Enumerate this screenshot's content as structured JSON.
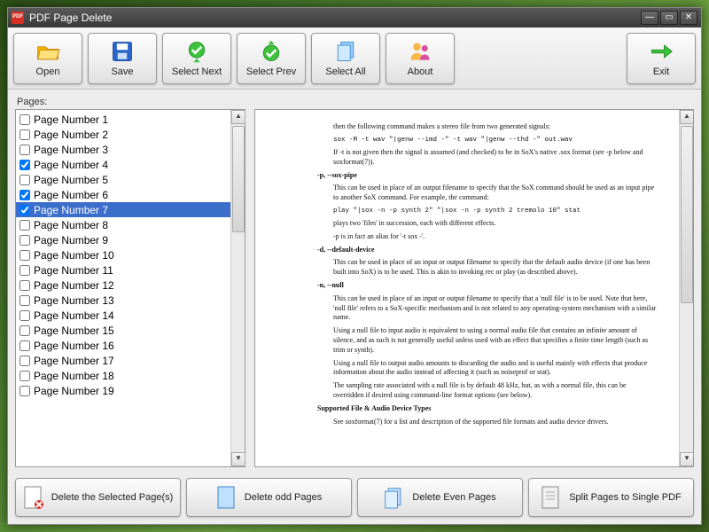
{
  "window": {
    "title": "PDF Page Delete"
  },
  "toolbar": {
    "open": "Open",
    "save": "Save",
    "select_next": "Select Next",
    "select_prev": "Select Prev",
    "select_all": "Select All",
    "about": "About",
    "exit": "Exit"
  },
  "pages_label": "Pages:",
  "pages": [
    {
      "label": "Page Number 1",
      "checked": false,
      "selected": false
    },
    {
      "label": "Page Number 2",
      "checked": false,
      "selected": false
    },
    {
      "label": "Page Number 3",
      "checked": false,
      "selected": false
    },
    {
      "label": "Page Number 4",
      "checked": true,
      "selected": false
    },
    {
      "label": "Page Number 5",
      "checked": false,
      "selected": false
    },
    {
      "label": "Page Number 6",
      "checked": true,
      "selected": false
    },
    {
      "label": "Page Number 7",
      "checked": true,
      "selected": true
    },
    {
      "label": "Page Number 8",
      "checked": false,
      "selected": false
    },
    {
      "label": "Page Number 9",
      "checked": false,
      "selected": false
    },
    {
      "label": "Page Number 10",
      "checked": false,
      "selected": false
    },
    {
      "label": "Page Number 11",
      "checked": false,
      "selected": false
    },
    {
      "label": "Page Number 12",
      "checked": false,
      "selected": false
    },
    {
      "label": "Page Number 13",
      "checked": false,
      "selected": false
    },
    {
      "label": "Page Number 14",
      "checked": false,
      "selected": false
    },
    {
      "label": "Page Number 15",
      "checked": false,
      "selected": false
    },
    {
      "label": "Page Number 16",
      "checked": false,
      "selected": false
    },
    {
      "label": "Page Number 17",
      "checked": false,
      "selected": false
    },
    {
      "label": "Page Number 18",
      "checked": false,
      "selected": false
    },
    {
      "label": "Page Number 19",
      "checked": false,
      "selected": false
    }
  ],
  "preview": {
    "lines": {
      "l1": "then the following command makes a stereo file from two generated signals:",
      "l2": "sox -M -t wav \"|genw --imd -\" -t wav \"|genw --thd -\" out.wav",
      "l3": "If -t is not given then the signal is assumed (and checked) to be in SoX's native .sox format (see -p below and soxformat(7)).",
      "o1": "-p, --sox-pipe",
      "l4": "This can be used in place of an output filename to specify that the SoX command should be used as an input pipe to another SoX command.  For example, the command:",
      "l5": "play \"|sox -n -p synth 2\" \"|sox -n -p synth 2 tremolo 10\" stat",
      "l6": "plays two 'files' in succession, each with different effects.",
      "l7": "-p is in fact an alias for '-t sox -'.",
      "o2": "-d, --default-device",
      "l8": "This can be used in place of an input or output filename to specify that the default audio device (if one has been built into SoX) is to be used.  This is akin to invoking rec or play (as described above).",
      "o3": "-n, --null",
      "l9": "This can be used in place of an input or output filename to specify that a 'null file' is to be used. Note that here, 'null file' refers to a SoX-specific mechanism and is not related to any operating-system mechanism with a similar name.",
      "l10": "Using a null file to input audio is equivalent to using a normal audio file that contains an infinite amount of silence, and as such is not generally useful unless used with an effect that specifies a finite time length (such as trim or synth).",
      "l11": "Using a null file to output audio amounts to discarding the audio and is useful mainly with effects that produce information about the audio instead of affecting it (such as noiseprof or stat).",
      "l12": "The sampling rate associated with a null file is by default 48 kHz, but, as with a normal file, this can be overridden if desired using command-line format options (see below).",
      "o4": "Supported File & Audio Device Types",
      "l13": "See soxformat(7) for a list and description of the supported file formats and audio device drivers."
    }
  },
  "bottom": {
    "delete_selected": "Delete the Selected Page(s)",
    "delete_odd": "Delete odd Pages",
    "delete_even": "Delete Even Pages",
    "split": "Split Pages to Single PDF"
  }
}
